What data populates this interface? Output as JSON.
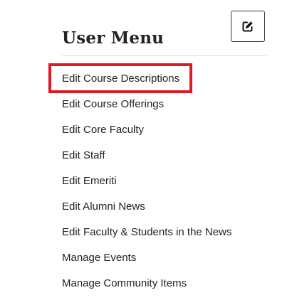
{
  "header": {
    "edit_icon": "edit-pencil-icon",
    "title": "User Menu"
  },
  "menu": {
    "items": [
      {
        "label": "Edit Course Descriptions",
        "highlighted": true
      },
      {
        "label": "Edit Course Offerings"
      },
      {
        "label": "Edit Core Faculty"
      },
      {
        "label": "Edit Staff"
      },
      {
        "label": "Edit Emeriti"
      },
      {
        "label": "Edit Alumni News"
      },
      {
        "label": "Edit Faculty & Students in the News"
      },
      {
        "label": "Manage Events"
      },
      {
        "label": "Manage Community Items"
      }
    ]
  },
  "colors": {
    "highlight_border": "#e01a22",
    "text": "#222222",
    "divider": "#dddddd"
  }
}
